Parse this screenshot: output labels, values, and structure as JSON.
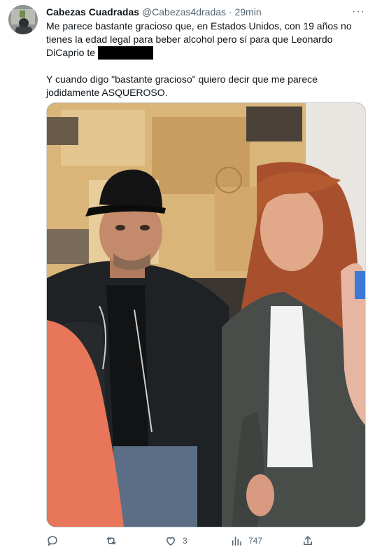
{
  "tweet": {
    "author_name": "Cabezas Cuadradas",
    "author_handle": "@Cabezas4dradas",
    "separator": "·",
    "time": "29min",
    "more_label": "···",
    "text_line1": "Me parece bastante gracioso que, en Estados Unidos, con 19 años no tienes la edad legal para beber alcohol pero sí para que Leonardo DiCaprio te",
    "text_line2": "Y cuando digo \"bastante gracioso\" quiero decir que me parece jodidamente ASQUEROSO.",
    "media_description_icons": [
      "photo"
    ]
  },
  "actions": {
    "reply_count": "",
    "retweet_count": "",
    "like_count": "3",
    "views_count": "747",
    "share_label": ""
  },
  "icons": {
    "reply": "reply-icon",
    "retweet": "retweet-icon",
    "like": "heart-icon",
    "views": "views-icon",
    "share": "share-icon"
  },
  "colors": {
    "text": "#0f1419",
    "secondary": "#536471",
    "border": "#cfd9de"
  }
}
